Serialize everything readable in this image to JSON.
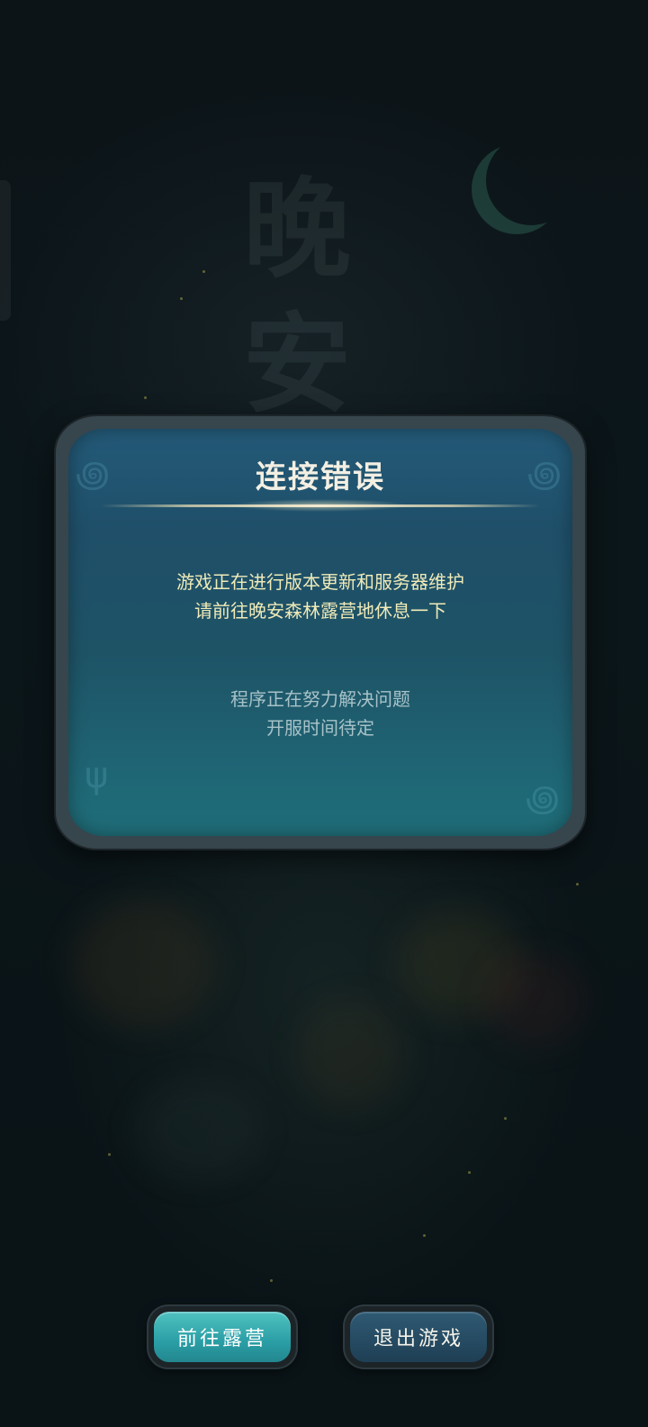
{
  "background": {
    "title_art": "晚安"
  },
  "dialog": {
    "title": "连接错误",
    "message_primary": [
      "游戏正在进行版本更新和服务器维护",
      "请前往晚安森林露营地休息一下"
    ],
    "message_secondary": [
      "程序正在努力解决问题",
      "开服时间待定"
    ]
  },
  "buttons": {
    "go_camp": "前往露营",
    "exit_game": "退出游戏"
  },
  "colors": {
    "dialog_title": "#f3efe3",
    "message_primary": "#f0ebb8",
    "message_secondary": "#a8c2c8",
    "go_button": "#2a9ea5",
    "exit_button": "#254a61"
  }
}
